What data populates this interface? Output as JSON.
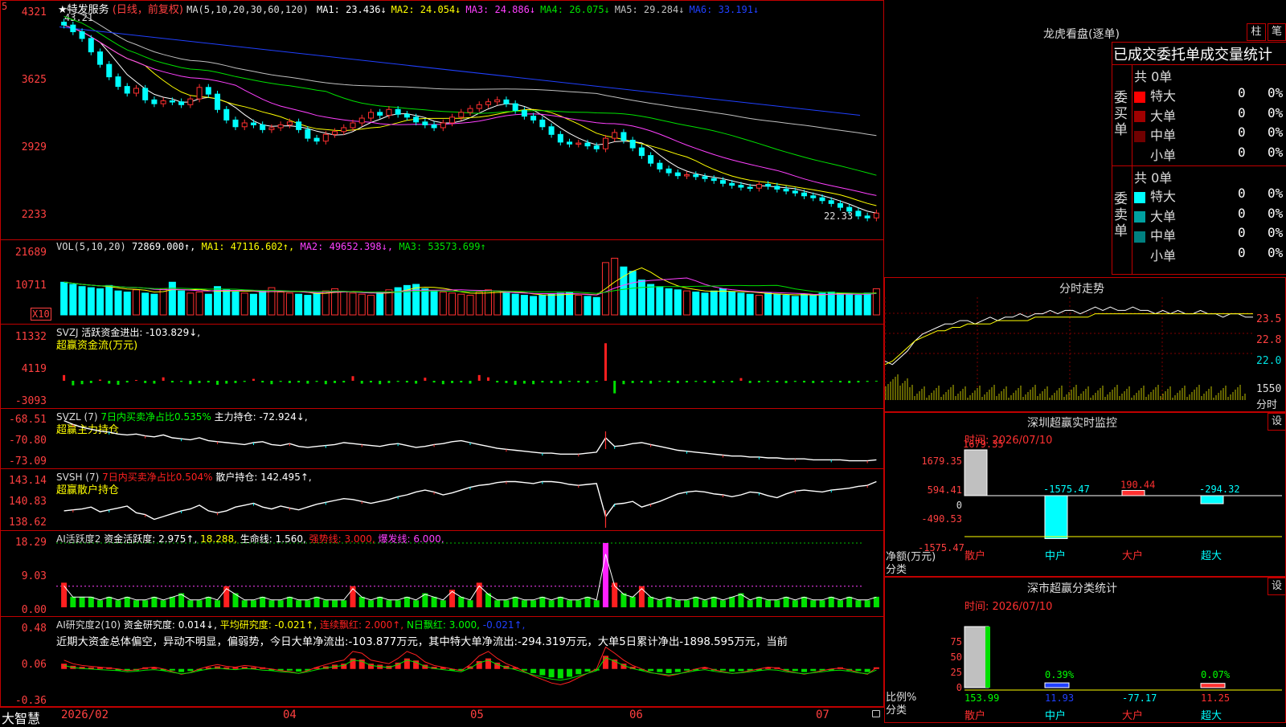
{
  "top_corner": "5",
  "stock": {
    "star": "★",
    "name": "特发服务",
    "mode": "(日线，前复权)",
    "ma_label": "MA(5,10,20,30,60,120)",
    "ma": [
      {
        "name": "MA1:",
        "value": "23.436↓",
        "color": "#ffffff"
      },
      {
        "name": "MA2:",
        "value": "24.054↓",
        "color": "#ffff00"
      },
      {
        "name": "MA3:",
        "value": "24.886↓",
        "color": "#ff40ff"
      },
      {
        "name": "MA4:",
        "value": "26.075↓",
        "color": "#00e000"
      },
      {
        "name": "MA5:",
        "value": "29.284↓",
        "color": "#c0c0c0"
      },
      {
        "name": "MA6:",
        "value": "33.191↓",
        "color": "#2040ff"
      }
    ],
    "high_mark": "43.21",
    "low_mark": "22.33"
  },
  "price_axis": [
    "4321",
    "3625",
    "2929",
    "2233"
  ],
  "vol": {
    "title": "VOL(5,10,20)",
    "value": "72869.000↑,",
    "ma1": "MA1: 47116.602↑,",
    "ma2": "MA2: 49652.398↓,",
    "ma3": "MA3: 53573.699↑",
    "axis": [
      "21689",
      "10711"
    ],
    "unit": "X10"
  },
  "svzj": {
    "title": "SVZJ",
    "line": "活跃资金进出: -103.829↓,",
    "sub": "超赢资金流(万元)",
    "axis": [
      "11332",
      "4119",
      "-3093"
    ]
  },
  "svzl": {
    "title": "SVZL (7)",
    "ratio": "7日内买卖净占比0.535%",
    "line": "主力持仓: -72.924↓,",
    "sub": "超赢主力持仓",
    "axis": [
      "-68.51",
      "-70.80",
      "-73.09"
    ]
  },
  "svsh": {
    "title": "SVSH (7)",
    "ratio": "7日内买卖净占比0.504%",
    "line": "散户持仓: 142.495↑,",
    "sub": "超赢散户持仓",
    "axis": [
      "143.14",
      "140.83",
      "138.62"
    ]
  },
  "ai1": {
    "title": "AI活跃度2",
    "a": "资金活跃度: 2.975↑,",
    "b": "18.288,",
    "c": "生命线: 1.560,",
    "d": "强势线: 3.000,",
    "e": "爆发线: 6.000,",
    "axis": [
      "18.29",
      "9.03",
      "0.00"
    ]
  },
  "ai2": {
    "title": "AI研究度2(10)",
    "a": "资金研究度: 0.014↓,",
    "b": "平均研究度: -0.021↑,",
    "c": "连续飘红: 2.000↑,",
    "d": "N日飘红: 3.000,",
    "e": "-0.021↑,",
    "comment": "近期大资金总体偏空，异动不明显，偏弱势，今日大单净流出:-103.877万元，其中特大单净流出:-294.319万元，大单5日累计净出-1898.595万元，当前",
    "axis": [
      "0.48",
      "0.06",
      "-0.36"
    ]
  },
  "footer": {
    "brand": "大智慧",
    "dates": [
      "2026/02",
      "04",
      "05",
      "06",
      "07"
    ]
  },
  "lhb": {
    "title": "龙虎看盘(逐单)",
    "btn1": "柱",
    "btn2": "笔",
    "header": "已成交委托单成交量统计",
    "buy_label": "委买单",
    "sell_label": "委卖单",
    "buy_total": "共 0单",
    "sell_total": "共 0单",
    "buy_rows": [
      {
        "name": "特大",
        "count": "0",
        "pct": "0%",
        "color": "#ff0000"
      },
      {
        "name": "大单",
        "count": "0",
        "pct": "0%",
        "color": "#a00000"
      },
      {
        "name": "中单",
        "count": "0",
        "pct": "0%",
        "color": "#700000"
      },
      {
        "name": "小单",
        "count": "0",
        "pct": "0%",
        "color": "#000000"
      }
    ],
    "sell_rows": [
      {
        "name": "特大",
        "count": "0",
        "pct": "0%",
        "color": "#00ffff"
      },
      {
        "name": "大单",
        "count": "0",
        "pct": "0%",
        "color": "#00a0a0"
      },
      {
        "name": "中单",
        "count": "0",
        "pct": "0%",
        "color": "#008080"
      },
      {
        "name": "小单",
        "count": "0",
        "pct": "0%",
        "color": "#000000"
      }
    ]
  },
  "fenshi": {
    "title": "分时走势",
    "axis": [
      "23.5",
      "22.8",
      "22.0"
    ],
    "vol_axis": "1550",
    "unit": "分时"
  },
  "sz_monitor": {
    "title": "深圳超赢实时监控",
    "btn": "设",
    "time": "时间: 2026/07/10",
    "axis": [
      "1679.35",
      "594.41",
      "0",
      "-490.53",
      "-1575.47"
    ],
    "unit1": "净额(万元)",
    "unit2": "分类",
    "cats": [
      "散户",
      "中户",
      "大户",
      "超大"
    ],
    "vals": [
      "1679.35",
      "-1575.47",
      "190.44",
      "-294.32"
    ]
  },
  "sz_stats": {
    "title": "深市超赢分类统计",
    "btn": "设",
    "time": "时间: 2026/07/10",
    "axis": [
      "75",
      "50",
      "25",
      "0"
    ],
    "unit1": "比例%",
    "unit2": "分类",
    "cats": [
      "散户",
      "中户",
      "大户",
      "超大"
    ],
    "top_labels": [
      "",
      "0.39%",
      "",
      "0.07%"
    ],
    "bottom_vals": [
      "153.99",
      "11.93",
      "-77.17",
      "11.25"
    ]
  },
  "chart_data": {
    "type": "candlestick",
    "x": [
      "2026/02",
      "04",
      "05",
      "06",
      "07"
    ],
    "ylim": [
      22.33,
      43.21
    ],
    "price_ticks": [
      43.21,
      36.25,
      29.29,
      22.33
    ],
    "closes": [
      43.0,
      42.3,
      41.6,
      40.2,
      38.9,
      37.6,
      36.6,
      35.9,
      36.4,
      35.2,
      34.8,
      35.1,
      35.0,
      34.7,
      35.3,
      36.5,
      35.8,
      34.2,
      33.1,
      32.4,
      32.8,
      32.6,
      32.1,
      32.3,
      32.6,
      32.9,
      32.1,
      31.2,
      30.9,
      31.6,
      31.9,
      32.3,
      32.8,
      33.3,
      33.9,
      33.6,
      34.2,
      33.7,
      33.4,
      32.9,
      32.6,
      32.3,
      32.8,
      33.4,
      33.9,
      34.3,
      34.7,
      35.0,
      35.2,
      34.8,
      34.1,
      33.5,
      33.1,
      32.4,
      31.6,
      30.8,
      30.6,
      30.7,
      30.4,
      30.1,
      31.2,
      31.8,
      31.0,
      30.2,
      29.4,
      28.6,
      28.0,
      27.6,
      27.3,
      27.4,
      27.2,
      27.0,
      26.8,
      26.5,
      26.3,
      26.1,
      26.0,
      26.4,
      26.2,
      25.9,
      25.7,
      25.5,
      25.2,
      25.0,
      24.7,
      24.4,
      24.0,
      23.6,
      23.1,
      22.9,
      23.4
    ],
    "volumes": [
      30,
      28,
      26,
      25,
      24,
      27,
      22,
      21,
      23,
      20,
      19,
      24,
      30,
      22,
      20,
      21,
      19,
      26,
      23,
      21,
      20,
      19,
      22,
      25,
      21,
      20,
      19,
      18,
      20,
      22,
      24,
      21,
      20,
      19,
      18,
      21,
      23,
      25,
      27,
      28,
      24,
      22,
      21,
      20,
      19,
      18,
      21,
      23,
      22,
      20,
      19,
      18,
      17,
      18,
      19,
      20,
      21,
      18,
      17,
      16,
      48,
      52,
      44,
      40,
      32,
      28,
      26,
      24,
      23,
      22,
      21,
      20,
      22,
      24,
      21,
      20,
      19,
      18,
      20,
      19,
      18,
      17,
      19,
      18,
      20,
      21,
      20,
      19,
      18,
      20,
      24
    ],
    "svzj": [
      1500,
      -800,
      -600,
      -400,
      300,
      -500,
      -700,
      -300,
      200,
      -400,
      -500,
      900,
      -300,
      -200,
      -600,
      -400,
      -300,
      -700,
      -500,
      -400,
      -200,
      500,
      -300,
      -600,
      -200,
      -400,
      -300,
      -500,
      -200,
      -600,
      -400,
      -300,
      1200,
      -500,
      -300,
      -600,
      -400,
      -200,
      -300,
      -500,
      800,
      -300,
      -600,
      -400,
      -300,
      -500,
      1500,
      900,
      -300,
      -400,
      -700,
      -500,
      -600,
      -300,
      -400,
      -500,
      -200,
      -300,
      -400,
      -200,
      9800,
      -2200,
      -600,
      -400,
      -300,
      -500,
      -200,
      -300,
      -400,
      -300,
      -200,
      -300,
      -400,
      -200,
      -300,
      700,
      -400,
      -300,
      -200,
      -300,
      -400,
      -200,
      -300,
      -400,
      -300,
      -200,
      -300,
      -400,
      -300,
      -200,
      -104
    ],
    "svzl": [
      -68.8,
      -69.2,
      -69.5,
      -69.7,
      -69.9,
      -70.0,
      -70.2,
      -70.3,
      -70.2,
      -70.4,
      -70.5,
      -70.3,
      -70.6,
      -70.7,
      -70.8,
      -70.6,
      -70.9,
      -71.0,
      -71.1,
      -71.2,
      -71.3,
      -71.1,
      -71.0,
      -71.3,
      -71.4,
      -71.2,
      -71.5,
      -71.6,
      -71.5,
      -71.4,
      -71.3,
      -71.1,
      -71.2,
      -71.3,
      -71.4,
      -71.5,
      -71.3,
      -71.2,
      -71.4,
      -71.6,
      -71.5,
      -71.3,
      -71.2,
      -71.0,
      -70.9,
      -71.1,
      -71.3,
      -71.5,
      -71.7,
      -71.8,
      -71.9,
      -72.0,
      -72.1,
      -72.2,
      -72.2,
      -72.3,
      -72.3,
      -72.3,
      -72.2,
      -72.1,
      -70.6,
      -71.5,
      -71.4,
      -71.2,
      -71.1,
      -71.3,
      -71.5,
      -71.7,
      -71.9,
      -72.0,
      -72.1,
      -72.2,
      -72.3,
      -72.4,
      -72.5,
      -72.5,
      -72.6,
      -72.6,
      -72.7,
      -72.7,
      -72.8,
      -72.8,
      -72.8,
      -72.9,
      -72.9,
      -72.9,
      -72.9,
      -73.0,
      -73.0,
      -73.0,
      -72.9
    ],
    "svsh": [
      139.8,
      139.9,
      140.0,
      140.2,
      139.7,
      139.9,
      140.1,
      140.3,
      139.6,
      139.4,
      138.9,
      139.2,
      139.5,
      139.8,
      140.0,
      140.4,
      139.8,
      139.6,
      139.8,
      140.2,
      140.4,
      140.6,
      140.2,
      140.0,
      140.3,
      140.1,
      139.9,
      140.2,
      140.5,
      140.7,
      140.9,
      141.1,
      141.0,
      140.8,
      140.6,
      140.8,
      141.0,
      141.3,
      141.5,
      141.8,
      142.0,
      141.8,
      141.5,
      141.7,
      142.0,
      142.3,
      142.5,
      142.6,
      142.8,
      142.9,
      142.9,
      142.8,
      142.7,
      142.9,
      142.9,
      142.8,
      142.6,
      142.5,
      142.6,
      142.7,
      139.2,
      140.5,
      140.6,
      140.8,
      140.2,
      140.5,
      140.8,
      141.2,
      141.6,
      141.8,
      141.9,
      141.8,
      141.6,
      141.5,
      141.3,
      141.5,
      141.8,
      141.7,
      141.4,
      141.2,
      141.6,
      141.9,
      142.0,
      141.9,
      141.8,
      142.0,
      142.1,
      142.2,
      142.4,
      142.5,
      142.9
    ],
    "ai1": [
      7,
      3,
      3,
      3,
      2,
      3,
      2,
      3,
      2,
      2,
      3,
      2,
      3,
      4,
      2,
      2,
      3,
      2,
      6,
      4,
      2,
      2,
      3,
      2,
      2,
      3,
      2,
      2,
      3,
      2,
      2,
      2,
      6,
      3,
      2,
      3,
      2,
      2,
      3,
      2,
      4,
      3,
      2,
      5,
      3,
      2,
      7,
      4,
      2,
      2,
      3,
      2,
      2,
      3,
      2,
      3,
      2,
      2,
      3,
      2,
      18.3,
      7,
      4,
      3,
      6,
      3,
      2,
      3,
      2,
      2,
      3,
      2,
      3,
      2,
      3,
      4,
      2,
      3,
      2,
      2,
      3,
      2,
      3,
      2,
      2,
      3,
      2,
      3,
      2,
      2,
      3
    ],
    "ai2": [
      0.1,
      0.06,
      0.04,
      0.03,
      0.02,
      0.01,
      0.0,
      -0.02,
      -0.01,
      0.01,
      0.02,
      0.0,
      -0.03,
      -0.06,
      -0.04,
      0.0,
      0.03,
      0.05,
      0.03,
      0.02,
      0.04,
      0.03,
      0.01,
      0.0,
      -0.02,
      -0.03,
      -0.05,
      -0.02,
      0.02,
      0.05,
      0.08,
      0.1,
      0.2,
      0.18,
      0.1,
      0.08,
      0.06,
      0.12,
      0.2,
      0.16,
      0.08,
      0.04,
      0.02,
      0.0,
      -0.02,
      0.05,
      0.15,
      0.2,
      0.12,
      0.06,
      0.02,
      -0.03,
      -0.08,
      -0.12,
      -0.16,
      -0.18,
      -0.15,
      -0.1,
      -0.05,
      0.0,
      0.25,
      0.18,
      0.1,
      0.04,
      0.0,
      -0.04,
      -0.06,
      -0.08,
      -0.06,
      -0.03,
      0.0,
      0.02,
      -0.01,
      -0.03,
      -0.05,
      -0.04,
      -0.02,
      0.0,
      0.02,
      0.01,
      -0.02,
      -0.04,
      -0.06,
      -0.04,
      -0.02,
      0.0,
      0.01,
      -0.01,
      -0.04,
      -0.06,
      0.014
    ],
    "fenshi_price": [
      22.1,
      22.0,
      22.2,
      22.4,
      22.7,
      22.9,
      23.0,
      23.1,
      23.2,
      23.2,
      23.3,
      23.3,
      23.2,
      23.3,
      23.4,
      23.3,
      23.4,
      23.4,
      23.5,
      23.4,
      23.5,
      23.5,
      23.6,
      23.5,
      23.6,
      23.6,
      23.5,
      23.6,
      23.7,
      23.6,
      23.7,
      23.6,
      23.6,
      23.7,
      23.6,
      23.6,
      23.5,
      23.6,
      23.5,
      23.6,
      23.5,
      23.5,
      23.6,
      23.5,
      23.5,
      23.4,
      23.5,
      23.5,
      23.4,
      23.4
    ],
    "fenshi_avg": [
      22.0,
      22.1,
      22.3,
      22.5,
      22.7,
      22.8,
      22.9,
      23.0,
      23.0,
      23.1,
      23.1,
      23.2,
      23.2,
      23.2,
      23.2,
      23.3,
      23.3,
      23.3,
      23.3,
      23.3,
      23.4,
      23.4,
      23.4,
      23.4,
      23.4,
      23.4,
      23.4,
      23.4,
      23.5,
      23.5,
      23.5,
      23.5,
      23.5,
      23.5,
      23.5,
      23.5,
      23.5,
      23.5,
      23.5,
      23.5,
      23.5,
      23.5,
      23.5,
      23.5,
      23.5,
      23.5,
      23.5,
      23.5,
      23.5,
      23.5
    ]
  }
}
